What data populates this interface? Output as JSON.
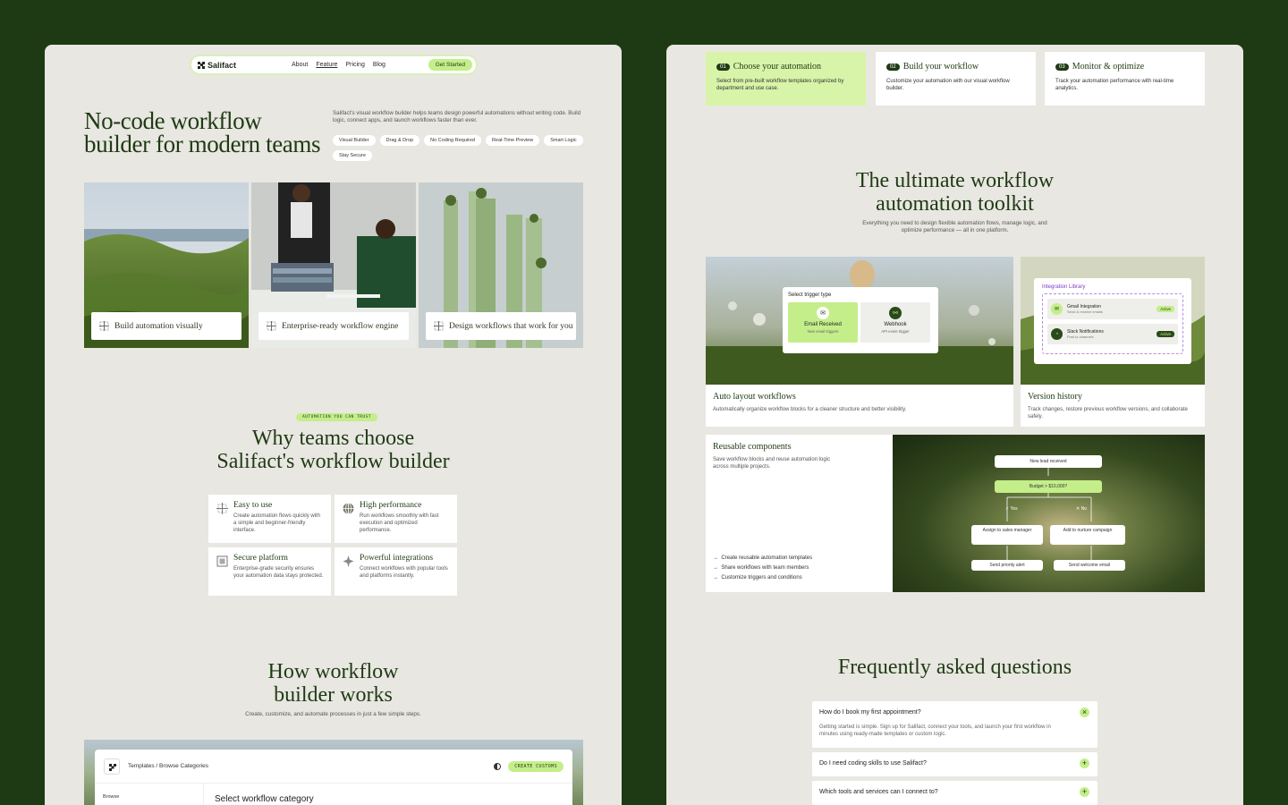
{
  "nav": {
    "brand": "Salifact",
    "links": [
      "About",
      "Feature",
      "Pricing",
      "Blog"
    ],
    "cta": "Get Started"
  },
  "hero": {
    "title_line1": "No-code workflow",
    "title_line2": "builder for modern teams",
    "description": "Salifact's visual workflow builder helps teams design powerful automations without writing code. Build logic, connect apps, and launch workflows faster than ever.",
    "tags": [
      "Visual Builder",
      "Drag & Drop",
      "No Coding Required",
      "Real-Time Preview",
      "Smart Logic",
      "Stay Secure"
    ]
  },
  "hero_cards": [
    {
      "label": "Build automation visually"
    },
    {
      "label": "Enterprise-ready workflow engine"
    },
    {
      "label": "Design workflows that work for you"
    }
  ],
  "why": {
    "badge": "AUTOMATION YOU CAN TRUST",
    "title_line1": "Why teams choose",
    "title_line2": "Salifact's workflow builder",
    "features": [
      {
        "title": "Easy to use",
        "desc": "Create automation flows quickly with a simple and beginner-friendly interface."
      },
      {
        "title": "High performance",
        "desc": "Run workflows smoothly with fast execution and optimized performance."
      },
      {
        "title": "Secure platform",
        "desc": "Enterprise-grade security ensures your automation data stays protected."
      },
      {
        "title": "Powerful integrations",
        "desc": "Connect workflows with popular tools and platforms instantly."
      }
    ]
  },
  "how": {
    "title_line1": "How workflow",
    "title_line2": "builder works",
    "subtitle": "Create, customize, and automate processes in just a few simple steps.",
    "app": {
      "breadcrumb": "Templates / Browse Categories",
      "cta": "CREATE CUSTOMS",
      "side_label": "Browse",
      "main_title": "Select workflow category"
    }
  },
  "steps": [
    {
      "num": "01",
      "title": "Choose your automation",
      "desc": "Select from pre-built workflow templates organized by department and use case."
    },
    {
      "num": "02",
      "title": "Build your workflow",
      "desc": "Customize your automation with our visual workflow builder."
    },
    {
      "num": "03",
      "title": "Monitor & optimize",
      "desc": "Track your automation performance with real-time analytics."
    }
  ],
  "toolkit": {
    "title_line1": "The ultimate workflow",
    "title_line2": "automation toolkit",
    "subtitle": "Everything you need to design flexible automation flows, manage logic, and optimize performance — all in one platform.",
    "auto_layout": {
      "title": "Auto layout workflows",
      "desc": "Automatically organize workflow blocks for a cleaner structure and better visibility.",
      "trigger_heading": "Select trigger type",
      "options": [
        {
          "label": "Email Received",
          "sub": "New email triggers"
        },
        {
          "label": "Webhook",
          "sub": "API event trigger"
        }
      ]
    },
    "version": {
      "title": "Version history",
      "desc": "Track changes, restore previous workflow versions, and collaborate safely.",
      "lib_heading": "Integration Library",
      "items": [
        {
          "title": "Gmail Integration",
          "sub": "Send & receive emails",
          "badge": "Active"
        },
        {
          "title": "Slack Notifications",
          "sub": "Post to channels",
          "badge": "Active"
        }
      ]
    },
    "reusable": {
      "title": "Reusable components",
      "desc": "Save workflow blocks and reuse automation logic across multiple projects.",
      "list": [
        "Create reusable automation templates",
        "Share workflows with team members",
        "Customize triggers and conditions"
      ],
      "flow": {
        "start": "New lead received",
        "condition": "Budget > $10,000?",
        "yes": "Yes",
        "no": "No",
        "yes_action": "Assign to sales manager",
        "no_action": "Add to nurture campaign",
        "yes_next": "Send priority alert",
        "no_next": "Send welcome email"
      }
    }
  },
  "faq": {
    "title": "Frequently asked questions",
    "items": [
      {
        "q": "How do I book my first appointment?",
        "a": "Getting started is simple. Sign up for Salifact, connect your tools, and launch your first workflow in minutes using ready-made templates or custom logic.",
        "toggle": "×"
      },
      {
        "q": "Do I need coding skills to use Salifact?",
        "toggle": "+"
      },
      {
        "q": "Which tools and services can I connect to?",
        "toggle": "+"
      }
    ]
  },
  "colors": {
    "background": "#1e3a14",
    "panel": "#e8e7e1",
    "accent": "#c4ee8a",
    "text_dark": "#1f3a14"
  }
}
